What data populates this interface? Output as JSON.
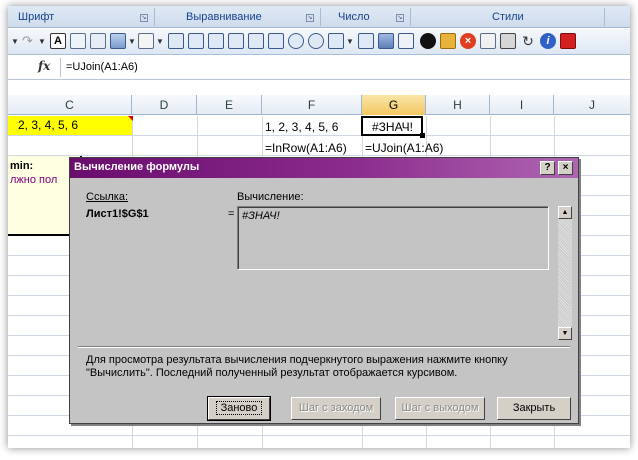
{
  "ribbon": {
    "groups": [
      "Шрифт",
      "Выравнивание",
      "Число",
      "Стили"
    ]
  },
  "formula_bar": {
    "fx_label": "fx",
    "formula": "=UJoin(A1:A6)"
  },
  "columns": [
    "C",
    "D",
    "E",
    "F",
    "G",
    "H",
    "I",
    "J"
  ],
  "active_column": "G",
  "cells": {
    "c1": "2, 3, 4, 5, 6",
    "f1": "1, 2, 3, 4, 5, 6",
    "g1": "#ЗНАЧ!",
    "f2": "=InRow(A1:A6)",
    "g2": "=UJoin(A1:A6)"
  },
  "comment": {
    "author": "min:",
    "text": "лжно пол"
  },
  "dialog": {
    "title": "Вычисление формулы",
    "help_button": "?",
    "close_button": "×",
    "reference_label": "Ссылка:",
    "reference_value": "Лист1!$G$1",
    "equals": "=",
    "evaluation_label": "Вычисление:",
    "evaluation_value": "#ЗНАЧ!",
    "info_text": "Для просмотра результата вычисления подчеркнутого выражения нажмите кнопку \"Вычислить\". Последний полученный результат отображается курсивом.",
    "buttons": {
      "restart": "Заново",
      "step_in": "Шаг с заходом",
      "step_out": "Шаг с выходом",
      "close": "Закрыть"
    }
  },
  "colors": {
    "title_bar": "#6a0d6d",
    "yellow_cell": "#ffff00",
    "active_header": "#f3c85f"
  }
}
